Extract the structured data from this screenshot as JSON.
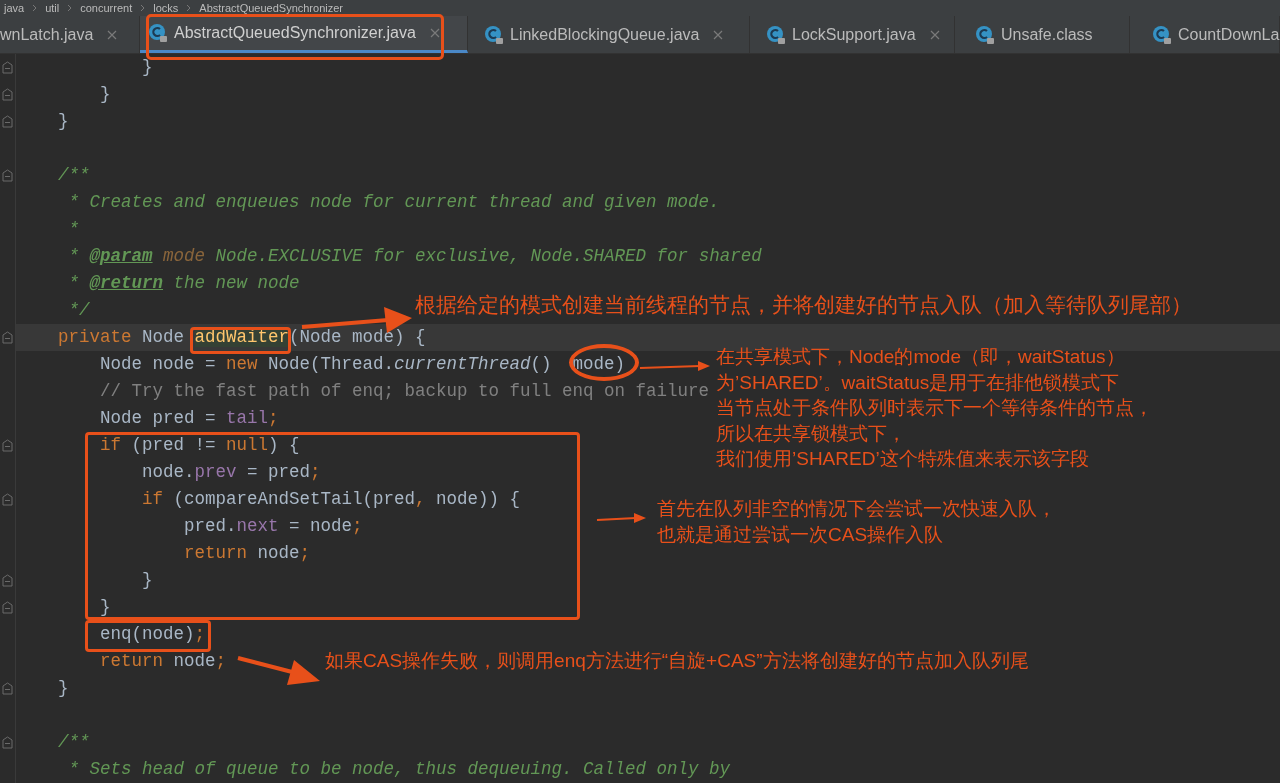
{
  "breadcrumb": [
    "java",
    "util",
    "concurrent",
    "locks",
    "AbstractQueuedSynchronizer"
  ],
  "tabs": [
    {
      "label": "wnLatch.java",
      "selected": false,
      "icon": false,
      "close": true
    },
    {
      "label": "AbstractQueuedSynchronizer.java",
      "selected": true,
      "icon": true,
      "close": true
    },
    {
      "label": "LinkedBlockingQueue.java",
      "selected": false,
      "icon": true,
      "close": true
    },
    {
      "label": "LockSupport.java",
      "selected": false,
      "icon": true,
      "close": true
    },
    {
      "label": "Unsafe.class",
      "selected": false,
      "icon": true,
      "close": false
    },
    {
      "label": "CountDownLa",
      "selected": false,
      "icon": true,
      "close": false
    }
  ],
  "code_blocks": [
    {
      "lines": [
        {
          "fold": true,
          "current": false,
          "tokens": [
            {
              "kind": "plain",
              "text": "            }"
            }
          ]
        },
        {
          "fold": true,
          "current": false,
          "tokens": [
            {
              "kind": "plain",
              "text": "        }"
            }
          ]
        },
        {
          "fold": true,
          "current": false,
          "tokens": [
            {
              "kind": "plain",
              "text": "    }"
            }
          ]
        }
      ]
    },
    {
      "lines": [
        {
          "fold": true,
          "current": false,
          "tokens": [
            {
              "kind": "doc",
              "text": "    /**"
            }
          ]
        },
        {
          "fold": false,
          "current": false,
          "tokens": [
            {
              "kind": "doc",
              "text": "     * Creates and enqueues node for current thread and given mode."
            }
          ]
        },
        {
          "fold": false,
          "current": false,
          "tokens": [
            {
              "kind": "doc",
              "text": "     *"
            }
          ]
        },
        {
          "fold": false,
          "current": false,
          "tokens": [
            {
              "kind": "doc",
              "text": "     * "
            },
            {
              "kind": "doctag",
              "text": "@param"
            },
            {
              "kind": "docparam",
              "text": " mode"
            },
            {
              "kind": "doc",
              "text": " Node.EXCLUSIVE for exclusive, Node.SHARED for shared"
            }
          ]
        },
        {
          "fold": false,
          "current": false,
          "tokens": [
            {
              "kind": "doc",
              "text": "     * "
            },
            {
              "kind": "doctag",
              "text": "@return"
            },
            {
              "kind": "doc",
              "text": " the new node"
            }
          ]
        },
        {
          "fold": false,
          "current": false,
          "tokens": [
            {
              "kind": "doc",
              "text": "     */"
            }
          ]
        },
        {
          "fold": true,
          "current": true,
          "tokens": [
            {
              "kind": "kw",
              "text": "    private"
            },
            {
              "kind": "plain",
              "text": " Node "
            },
            {
              "kind": "method",
              "text": "addWaiter"
            },
            {
              "kind": "plain",
              "text": "(Node mode) {"
            }
          ]
        },
        {
          "fold": false,
          "current": false,
          "tokens": [
            {
              "kind": "plain",
              "text": "        Node node = "
            },
            {
              "kind": "kw",
              "text": "new"
            },
            {
              "kind": "plain",
              "text": " Node(Thread."
            },
            {
              "kind": "call",
              "text": "currentThread"
            },
            {
              "kind": "plain",
              "text": "()  mode)"
            }
          ]
        },
        {
          "fold": false,
          "current": false,
          "tokens": [
            {
              "kind": "comment",
              "text": "        // Try the fast path of enq; backup to full enq on failure"
            }
          ]
        },
        {
          "fold": false,
          "current": false,
          "tokens": [
            {
              "kind": "plain",
              "text": "        Node pred = "
            },
            {
              "kind": "field",
              "text": "tail"
            },
            {
              "kind": "kw",
              "text": ";"
            }
          ]
        },
        {
          "fold": true,
          "current": false,
          "tokens": [
            {
              "kind": "kw",
              "text": "        if"
            },
            {
              "kind": "plain",
              "text": " (pred != "
            },
            {
              "kind": "kw",
              "text": "null"
            },
            {
              "kind": "plain",
              "text": ") {"
            }
          ]
        },
        {
          "fold": false,
          "current": false,
          "tokens": [
            {
              "kind": "plain",
              "text": "            node."
            },
            {
              "kind": "field",
              "text": "prev"
            },
            {
              "kind": "plain",
              "text": " = pred"
            },
            {
              "kind": "kw",
              "text": ";"
            }
          ]
        },
        {
          "fold": true,
          "current": false,
          "tokens": [
            {
              "kind": "kw",
              "text": "            if"
            },
            {
              "kind": "plain",
              "text": " (compareAndSetTail(pred"
            },
            {
              "kind": "kw",
              "text": ","
            },
            {
              "kind": "plain",
              "text": " node)) {"
            }
          ]
        },
        {
          "fold": false,
          "current": false,
          "tokens": [
            {
              "kind": "plain",
              "text": "                pred."
            },
            {
              "kind": "field",
              "text": "next"
            },
            {
              "kind": "plain",
              "text": " = node"
            },
            {
              "kind": "kw",
              "text": ";"
            }
          ]
        },
        {
          "fold": false,
          "current": false,
          "tokens": [
            {
              "kind": "kw",
              "text": "                return"
            },
            {
              "kind": "plain",
              "text": " node"
            },
            {
              "kind": "kw",
              "text": ";"
            }
          ]
        },
        {
          "fold": true,
          "current": false,
          "tokens": [
            {
              "kind": "plain",
              "text": "            }"
            }
          ]
        },
        {
          "fold": true,
          "current": false,
          "tokens": [
            {
              "kind": "plain",
              "text": "        }"
            }
          ]
        },
        {
          "fold": false,
          "current": false,
          "tokens": [
            {
              "kind": "plain",
              "text": "        enq(node)"
            },
            {
              "kind": "kw",
              "text": ";"
            }
          ]
        },
        {
          "fold": false,
          "current": false,
          "tokens": [
            {
              "kind": "kw",
              "text": "        return"
            },
            {
              "kind": "plain",
              "text": " node"
            },
            {
              "kind": "kw",
              "text": ";"
            }
          ]
        },
        {
          "fold": true,
          "current": false,
          "tokens": [
            {
              "kind": "plain",
              "text": "    }"
            }
          ]
        }
      ]
    },
    {
      "lines": [
        {
          "fold": true,
          "current": false,
          "tokens": [
            {
              "kind": "doc",
              "text": "    /**"
            }
          ]
        },
        {
          "fold": false,
          "current": false,
          "tokens": [
            {
              "kind": "doc",
              "text": "     * Sets head of queue to be node, thus dequeuing. Called only by"
            }
          ]
        }
      ]
    }
  ],
  "annotations": [
    {
      "kind": "note",
      "lines": [
        "根据给定的模式创建当前线程的节点，并将创建好的节点入队（加入等待队列尾部）"
      ]
    },
    {
      "kind": "note",
      "lines": [
        "在共享模式下，Node的mode（即，waitStatus）",
        "为’SHARED’。waitStatus是用于在排他锁模式下",
        "当节点处于条件队列时表示下一个等待条件的节点，",
        "所以在共享锁模式下，",
        "我们使用’SHARED’这个特殊值来表示该字段"
      ]
    },
    {
      "kind": "note",
      "lines": [
        "首先在队列非空的情况下会尝试一次快速入队，",
        "也就是通过尝试一次CAS操作入队"
      ]
    },
    {
      "kind": "note",
      "lines": [
        "如果CAS操作失败，则调用enq方法进行“自旋+CAS”方法将创建好的节点加入队列尾"
      ]
    }
  ]
}
